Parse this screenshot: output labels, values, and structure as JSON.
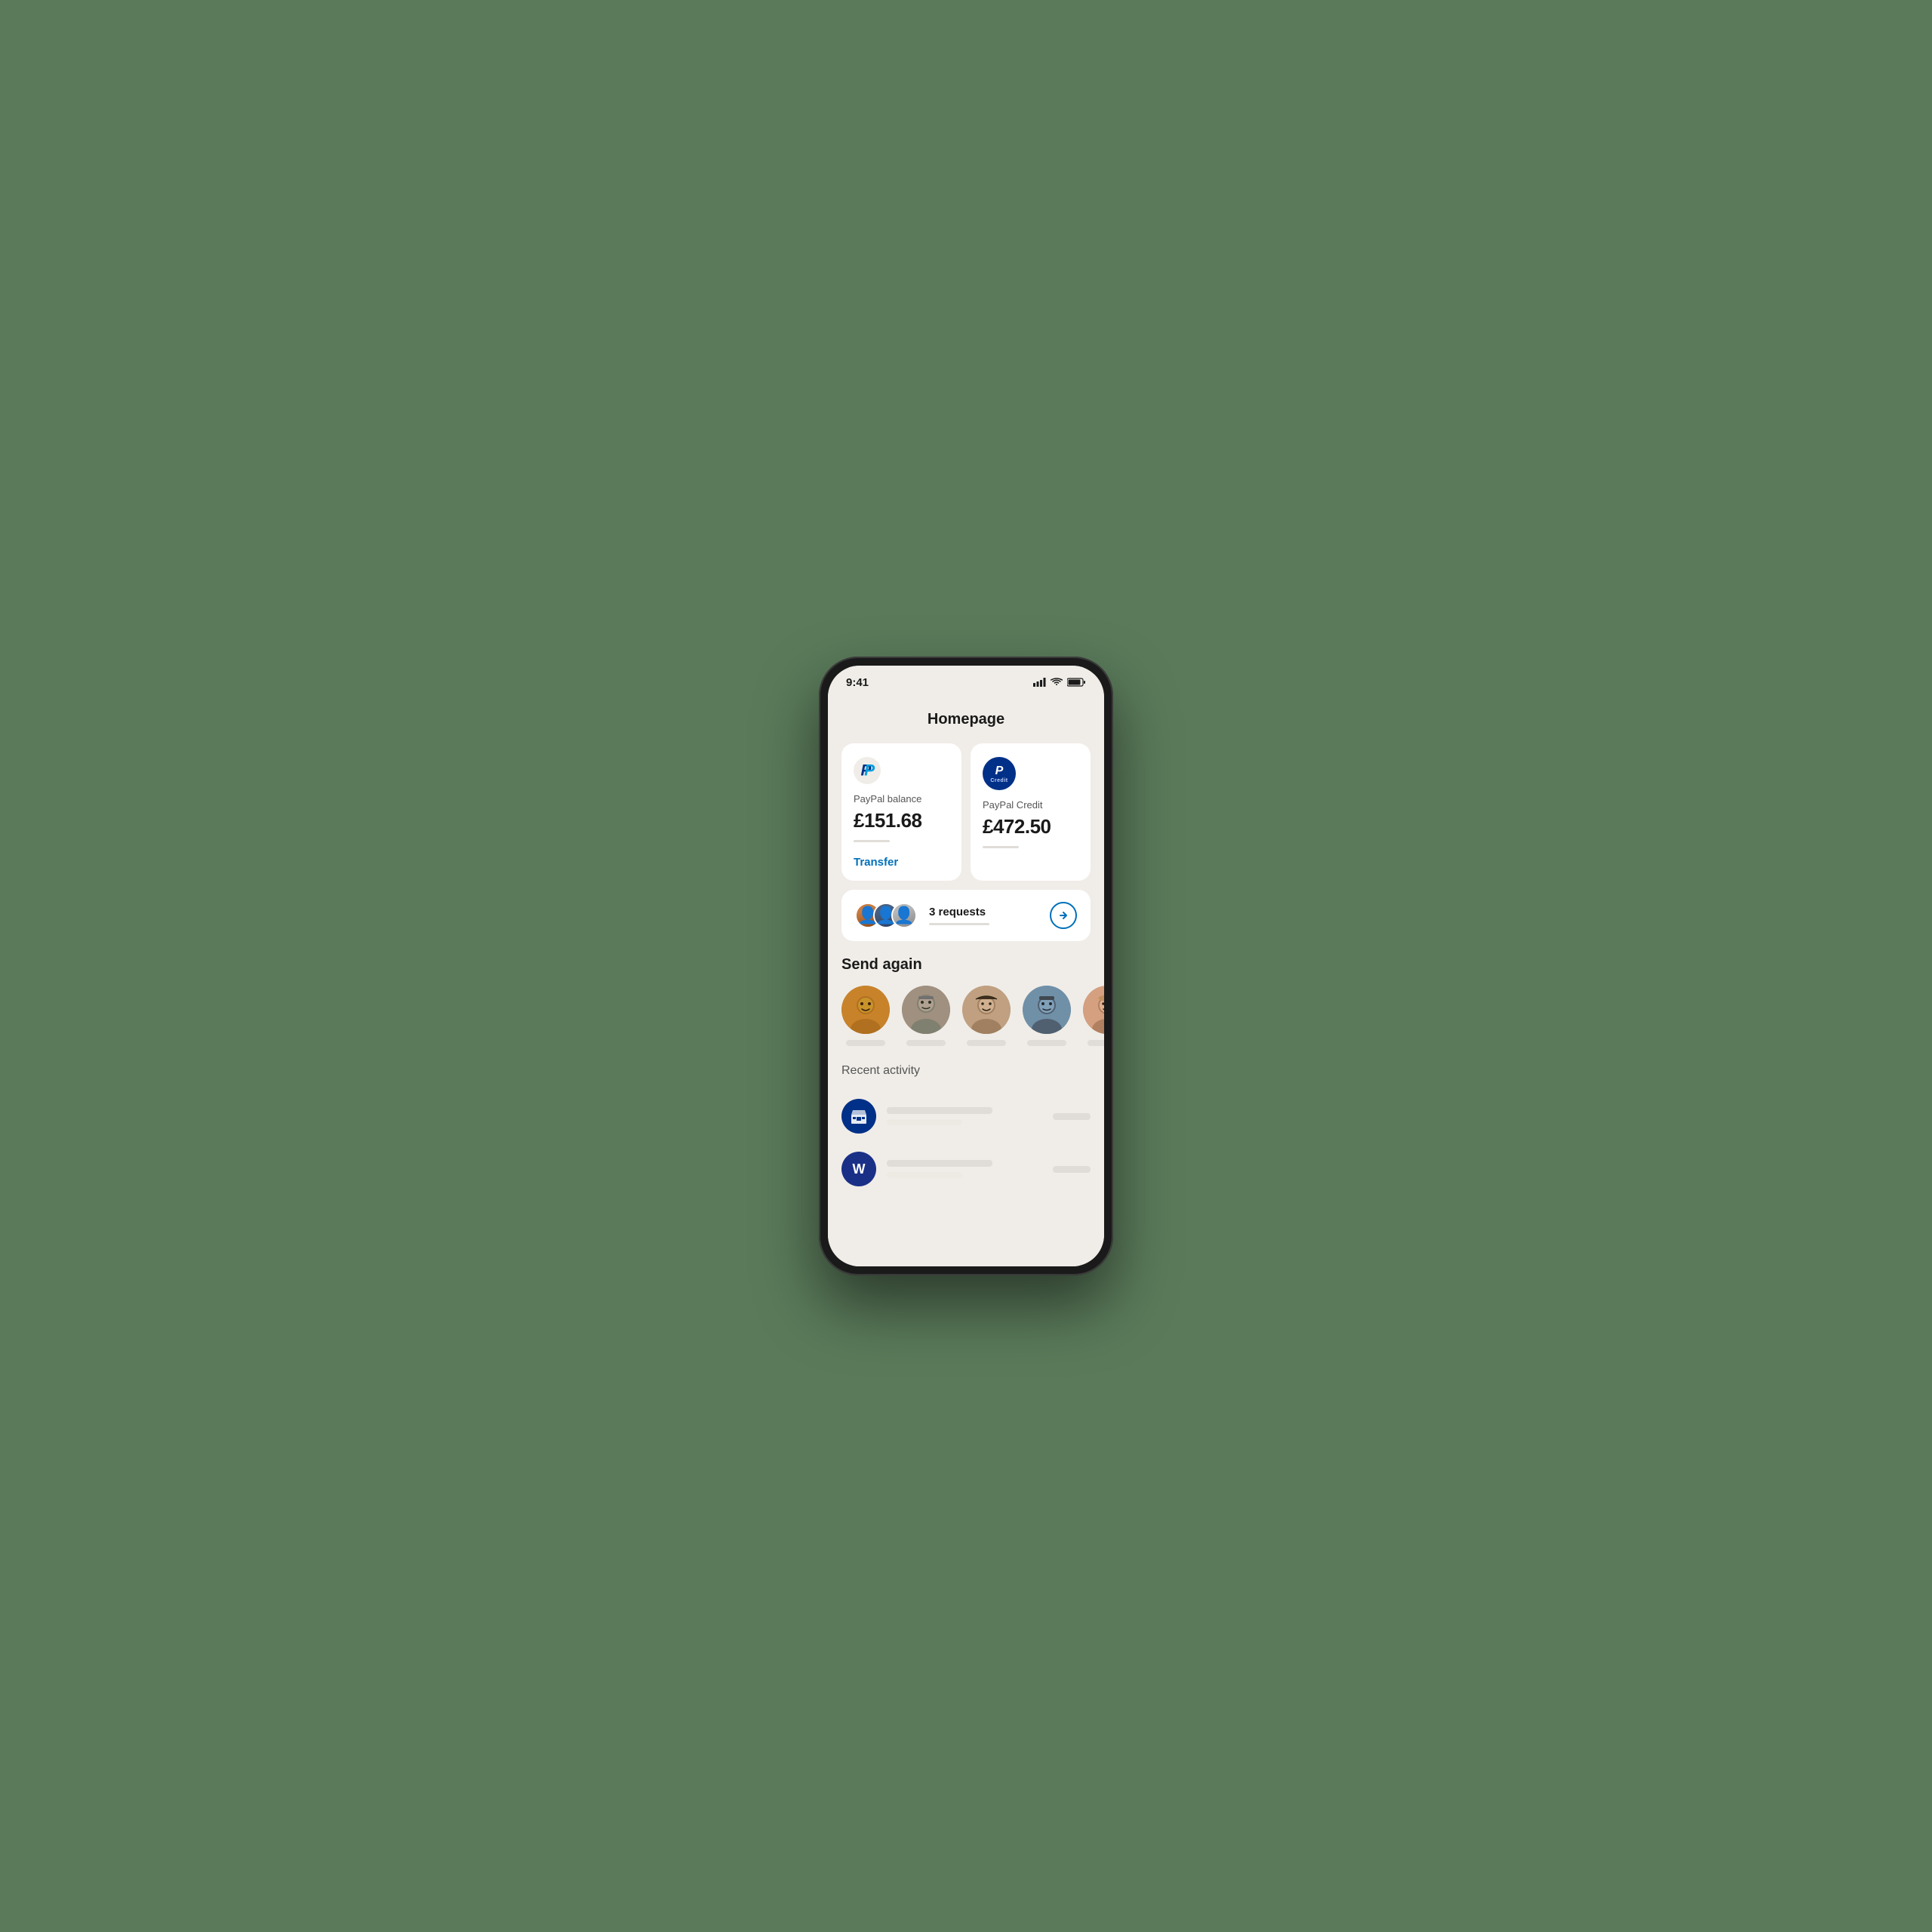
{
  "page": {
    "title": "Homepage"
  },
  "paypal_balance": {
    "label": "PayPal balance",
    "amount": "£151.68",
    "transfer_link": "Transfer"
  },
  "paypal_credit": {
    "label": "PayPal Credit",
    "amount": "£472.50",
    "logo_line1": "P",
    "logo_line2": "Credit"
  },
  "requests": {
    "count_text": "3 requests"
  },
  "send_again": {
    "title": "Send again"
  },
  "recent_activity": {
    "title": "Recent activity"
  },
  "colors": {
    "paypal_blue": "#0070ba",
    "paypal_dark_blue": "#003087",
    "accent_blue": "#0070ba"
  }
}
